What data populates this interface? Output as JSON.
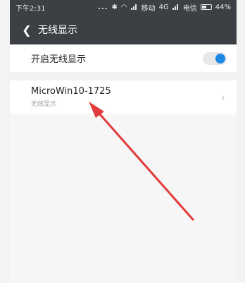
{
  "status_bar": {
    "time": "下午2:31",
    "dots": "...",
    "carrier1": "移动",
    "network": "4G",
    "carrier2": "电信",
    "battery_label": "44%"
  },
  "header": {
    "title": "无线显示",
    "back_icon": "chevron-left-icon"
  },
  "toggle_row": {
    "label": "开启无线显示",
    "enabled": true
  },
  "devices": [
    {
      "name": "MicroWin10-1725",
      "subtitle": "无线显示"
    }
  ],
  "colors": {
    "header_bg": "#3c3f44",
    "toggle_on": "#1e88e5",
    "arrow": "#e23b3b"
  }
}
